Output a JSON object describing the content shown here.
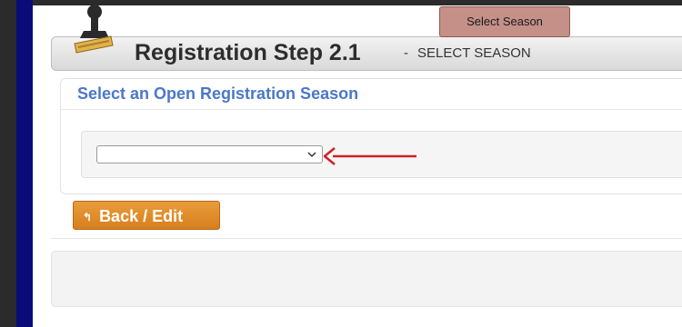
{
  "badge": {
    "label": "Select Season"
  },
  "header": {
    "title": "Registration Step 2.1",
    "separator": "-",
    "subtitle": "SELECT SEASON"
  },
  "panel": {
    "title": "Select an Open Registration Season",
    "select_value": ""
  },
  "buttons": {
    "back_label": "Back / Edit",
    "back_icon": "↰"
  },
  "colors": {
    "badge_bg": "#c49088",
    "panel_title": "#4a78c8",
    "back_button": "#e08a28",
    "arrow": "#d0202a",
    "side_bar": "#0a0a78"
  },
  "icons": {
    "header": "stamp-icon",
    "annotation": "red-arrow"
  }
}
